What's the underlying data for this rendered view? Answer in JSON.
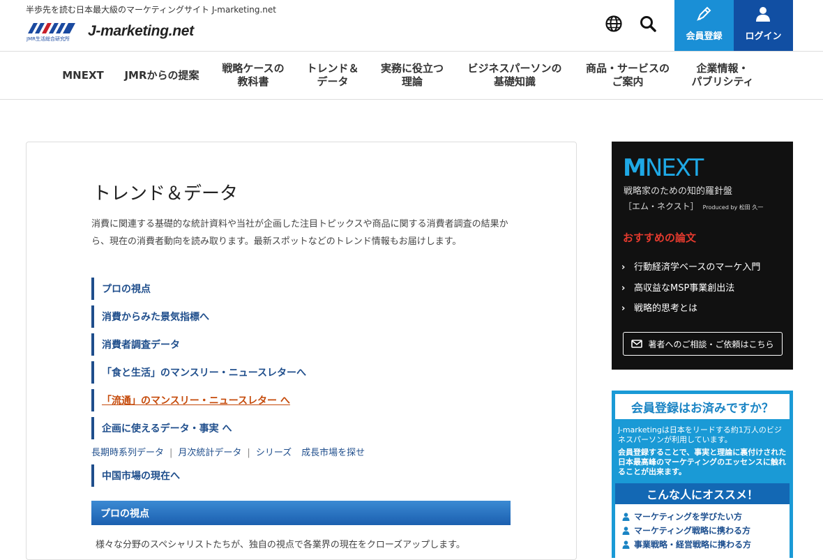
{
  "header": {
    "tagline": "半歩先を読む日本最大級のマーケティングサイト J-marketing.net",
    "logo_sub_text": "JMR生活総合研究所",
    "logo_text": "J-marketing.net",
    "register_label": "会員登録",
    "login_label": "ログイン"
  },
  "nav": {
    "items": [
      {
        "lines": [
          "MNEXT"
        ]
      },
      {
        "lines": [
          "JMRからの提案"
        ]
      },
      {
        "lines": [
          "戦略ケースの",
          "教科書"
        ]
      },
      {
        "lines": [
          "トレンド＆",
          "データ"
        ]
      },
      {
        "lines": [
          "実務に役立つ",
          "理論"
        ]
      },
      {
        "lines": [
          "ビジネスパーソンの",
          "基礎知識"
        ]
      },
      {
        "lines": [
          "商品・サービスの",
          "ご案内"
        ]
      },
      {
        "lines": [
          "企業情報・",
          "パブリシティ"
        ]
      }
    ]
  },
  "main": {
    "title": "トレンド＆データ",
    "intro": "消費に関連する基礎的な統計資料や当社が企画した注目トピックスや商品に関する消費者調査の結果から、現在の消費者動向を読み取ります。最新スポットなどのトレンド情報もお届けします。",
    "section_links": [
      "プロの視点",
      "消費からみた景気指標へ",
      "消費者調査データ",
      "「食と生活」のマンスリー・ニュースレターへ",
      "「流通」のマンスリー・ニュースレター へ",
      "企画に使えるデータ・事実 へ"
    ],
    "sub_links": [
      "長期時系列データ",
      "月次統計データ",
      "シリーズ",
      "成長市場を探せ"
    ],
    "china_link": "中国市場の現在へ",
    "pro_bar_title": "プロの視点",
    "pro_desc": "様々な分野のスペシャリストたちが、独自の視点で各業界の現在をクローズアップします。"
  },
  "sidebar": {
    "mnext": {
      "logo_bold": "M",
      "logo_rest": "NEXT",
      "subtitle": "戦略家のための知的羅針盤",
      "subtitle2": "［エム・ネクスト］",
      "produced_by": "Produced by  松田 久一",
      "recommend_title": "おすすめの論文",
      "recommend_items": [
        "行動経済学ベースのマーケ入門",
        "高収益なMSP事業創出法",
        "戦略的思考とは"
      ],
      "contact_label": "著者へのご相談・ご依頼はこちら"
    },
    "member": {
      "title": "会員登録はお済みですか？",
      "p1": "J-marketingは日本をリードする約1万人のビジネスパーソンが利用しています。",
      "p2": "会員登録することで、事実と理論に裏付けされた日本最高峰のマーケティングのエッセンスに触れることが出来ます。",
      "recommend_for": "こんな人にオススメ！",
      "list": [
        "マーケティングを学びたい方",
        "マーケティング戦略に携わる方",
        "事業戦略・経営戦略に携わる方"
      ]
    }
  },
  "colors": {
    "register_bg": "#1a8fd6",
    "login_bg": "#114fa3",
    "link_blue": "#1f4e8c",
    "hover_orange": "#c54a0a",
    "mnext_accent": "#1fa9e6",
    "recommend_red": "#e53a2e"
  },
  "icons": {
    "globe": "globe-icon",
    "search": "search-icon",
    "register": "pen-icon",
    "login": "user-icon",
    "contact": "mail-icon",
    "list": "person-icon"
  }
}
